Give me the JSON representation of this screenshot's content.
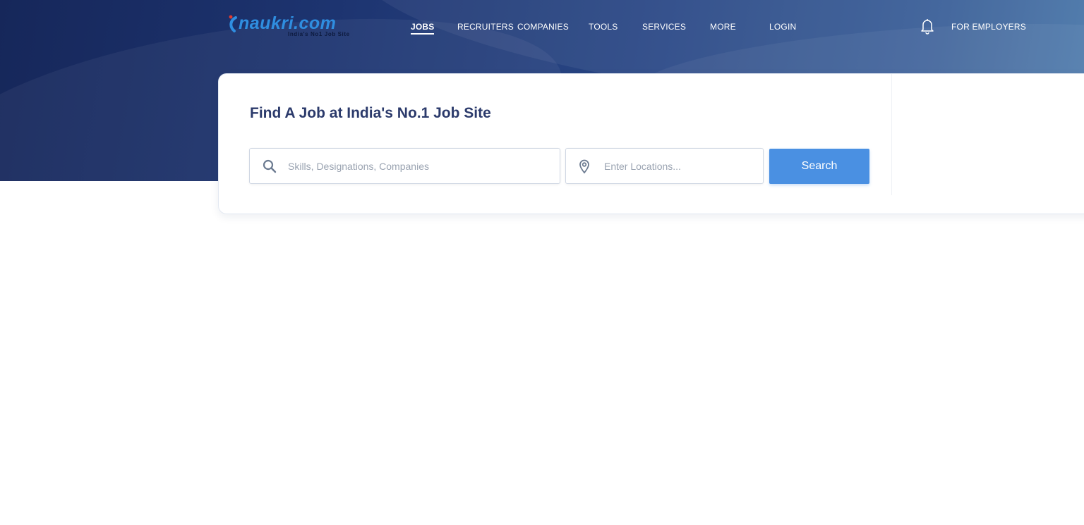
{
  "brand": {
    "name": "naukri.com",
    "tagline": "India's No1 Job Site",
    "icon": "naukri-swoosh-logo"
  },
  "nav": {
    "items": [
      {
        "label": "JOBS",
        "active": true
      },
      {
        "label": "RECRUITERS",
        "active": false
      },
      {
        "label": "COMPANIES",
        "active": false
      },
      {
        "label": "TOOLS",
        "active": false
      },
      {
        "label": "SERVICES",
        "active": false
      },
      {
        "label": "MORE",
        "active": false
      },
      {
        "label": "LOGIN",
        "active": false
      }
    ],
    "notifications_icon": "bell-icon",
    "employers_label": "FOR EMPLOYERS"
  },
  "search": {
    "heading": "Find A Job at India's No.1 Job Site",
    "skills_placeholder": "Skills, Designations, Companies",
    "skills_value": "",
    "skills_icon": "search-icon",
    "location_placeholder": "Enter Locations...",
    "location_value": "",
    "location_icon": "location-pin-icon",
    "button_label": "Search"
  },
  "colors": {
    "hero_dark": "#16275a",
    "hero_light": "#4a78aa",
    "accent": "#4a90e2",
    "heading": "#2b3a6b",
    "brand_blue": "#2f8ee0",
    "brand_red": "#e23a2e"
  }
}
